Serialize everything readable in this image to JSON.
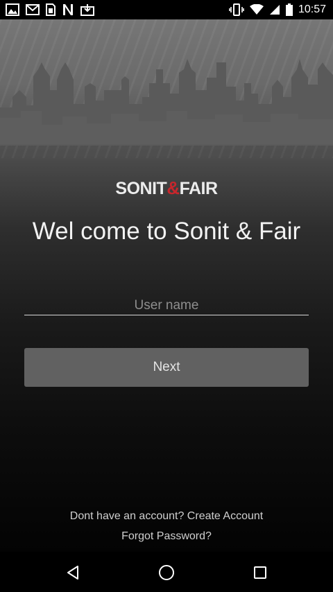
{
  "status_bar": {
    "time": "10:57",
    "icons": [
      "gallery-icon",
      "gmail-icon",
      "sim-card-icon",
      "netflix-icon",
      "download-icon",
      "vibrate-icon",
      "wifi-icon",
      "cell-signal-icon",
      "battery-icon"
    ]
  },
  "brand": {
    "logo_left": "SONIT",
    "logo_amp": "&",
    "logo_right": "FAIR",
    "accent_color": "#c8262c"
  },
  "welcome_text": "Wel come to Sonit & Fair",
  "form": {
    "username_placeholder": "User name",
    "username_value": "",
    "next_label": "Next"
  },
  "links": {
    "create_account": "Dont have an account? Create Account",
    "forgot_password": "Forgot Password?"
  },
  "nav_bar": {
    "icons": [
      "back-icon",
      "home-icon",
      "recents-icon"
    ]
  }
}
